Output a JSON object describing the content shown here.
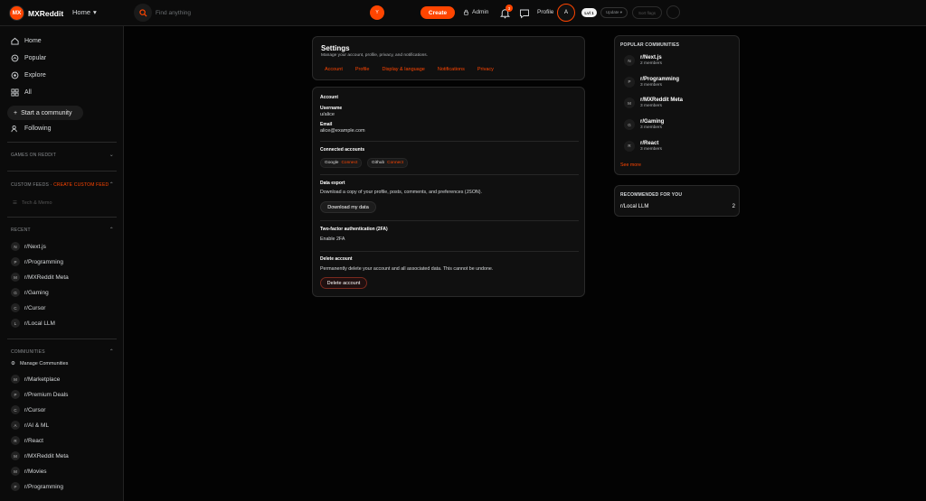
{
  "brand": {
    "logo_text": "MX",
    "name": "MXReddit",
    "accent": "#ff4500"
  },
  "header": {
    "home_label": "Home",
    "search_placeholder": "Find anything",
    "search_bubble": "Y",
    "create_label": "Create",
    "admin_label": "Admin",
    "notification_count": "3",
    "profile_label": "Profile",
    "avatar_initial": "A",
    "level_label": "Lvl 1",
    "update_label": "Update ▾",
    "ghost_label": "Sort flags"
  },
  "sidebar": {
    "nav": [
      {
        "label": "Home",
        "icon": "home-icon"
      },
      {
        "label": "Popular",
        "icon": "popular-icon"
      },
      {
        "label": "Explore",
        "icon": "explore-icon"
      },
      {
        "label": "All",
        "icon": "all-icon"
      }
    ],
    "start_community": "Start a community",
    "following": "Following",
    "games_header": "GAMES ON REDDIT",
    "custom_feeds_header": "CUSTOM FEEDS",
    "custom_feeds_sep": " · ",
    "create_custom_feed": "CREATE CUSTOM FEED",
    "custom_feed_item": "Tech & Memo",
    "recent_header": "RECENT",
    "recent": [
      {
        "initial": "N",
        "name": "r/Next.js"
      },
      {
        "initial": "P",
        "name": "r/Programming"
      },
      {
        "initial": "M",
        "name": "r/MXReddit Meta"
      },
      {
        "initial": "G",
        "name": "r/Gaming"
      },
      {
        "initial": "C",
        "name": "r/Cursor"
      },
      {
        "initial": "L",
        "name": "r/Local LLM"
      }
    ],
    "communities_header": "COMMUNITIES",
    "manage_communities": "Manage Communities",
    "communities": [
      {
        "initial": "M",
        "name": "r/Marketplace"
      },
      {
        "initial": "P",
        "name": "r/Premium Deals"
      },
      {
        "initial": "C",
        "name": "r/Cursor"
      },
      {
        "initial": "A",
        "name": "r/AI & ML"
      },
      {
        "initial": "R",
        "name": "r/React"
      },
      {
        "initial": "M",
        "name": "r/MXReddit Meta"
      },
      {
        "initial": "M",
        "name": "r/Movies"
      },
      {
        "initial": "P",
        "name": "r/Programming"
      }
    ]
  },
  "settings": {
    "title": "Settings",
    "subtitle": "Manage your account, profile, privacy, and notifications.",
    "tabs": [
      "Account",
      "Profile",
      "Display & language",
      "Notifications",
      "Privacy"
    ]
  },
  "account": {
    "section_title": "Account",
    "username_label": "Username",
    "username_value": "u/alice",
    "email_label": "Email",
    "email_value": "alice@example.com",
    "connected_title": "Connected accounts",
    "connections": [
      {
        "name": "Google",
        "action": "Connect"
      },
      {
        "name": "Github",
        "action": "Connect"
      }
    ],
    "export_title": "Data export",
    "export_desc": "Download a copy of your profile, posts, comments, and preferences (JSON).",
    "download_label": "Download my data",
    "twofa_title": "Two-factor authentication (2FA)",
    "twofa_value": "Enable 2FA",
    "delete_title": "Delete account",
    "delete_desc": "Permanently delete your account and all associated data. This cannot be undone.",
    "delete_label": "Delete account"
  },
  "popular": {
    "header": "POPULAR COMMUNITIES",
    "items": [
      {
        "initial": "N",
        "name": "r/Next.js",
        "members": "2 members"
      },
      {
        "initial": "P",
        "name": "r/Programming",
        "members": "3 members"
      },
      {
        "initial": "M",
        "name": "r/MXReddit Meta",
        "members": "3 members"
      },
      {
        "initial": "G",
        "name": "r/Gaming",
        "members": "3 members"
      },
      {
        "initial": "R",
        "name": "r/React",
        "members": "3 members"
      }
    ],
    "see_more": "See more"
  },
  "recommended": {
    "header": "RECOMMENDED FOR YOU",
    "items": [
      {
        "name": "r/Local LLM",
        "count": "2"
      }
    ]
  }
}
